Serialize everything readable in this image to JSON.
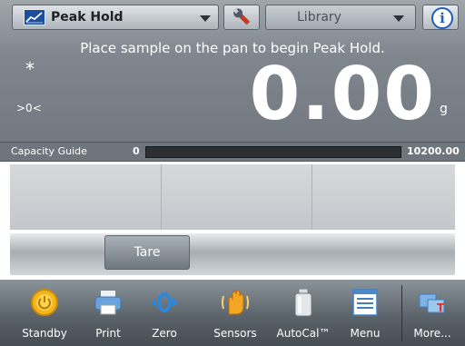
{
  "header": {
    "app_name": "Peak Hold",
    "library_label": "Library",
    "app_icon": "line-graph-icon",
    "settings_icon": "wrench-icon",
    "info_icon": "info-icon",
    "info_glyph": "i"
  },
  "display": {
    "instruction": "Place sample on the pan to begin Peak Hold.",
    "stability_indicator": "*",
    "center_zero_indicator": ">0<",
    "weight": "0.00",
    "unit": "g"
  },
  "capacity_guide": {
    "label": "Capacity Guide",
    "min": "0",
    "max": "10200.00",
    "fill_fraction": 0.0
  },
  "tare": {
    "label": "Tare"
  },
  "nav": [
    {
      "label": "Standby",
      "icon": "standby-icon"
    },
    {
      "label": "Print",
      "icon": "printer-icon"
    },
    {
      "label": "Zero",
      "icon": "zero-icon"
    },
    {
      "label": "Sensors",
      "icon": "hand-sensor-icon"
    },
    {
      "label": "AutoCal™",
      "icon": "calibration-weight-icon"
    },
    {
      "label": "Menu",
      "icon": "menu-icon"
    },
    {
      "label": "More...",
      "icon": "more-icon"
    }
  ],
  "colors": {
    "accent_blue": "#1f5fb5",
    "capacity_fill": "#4fd04f",
    "header_bg": "#7f868d"
  }
}
